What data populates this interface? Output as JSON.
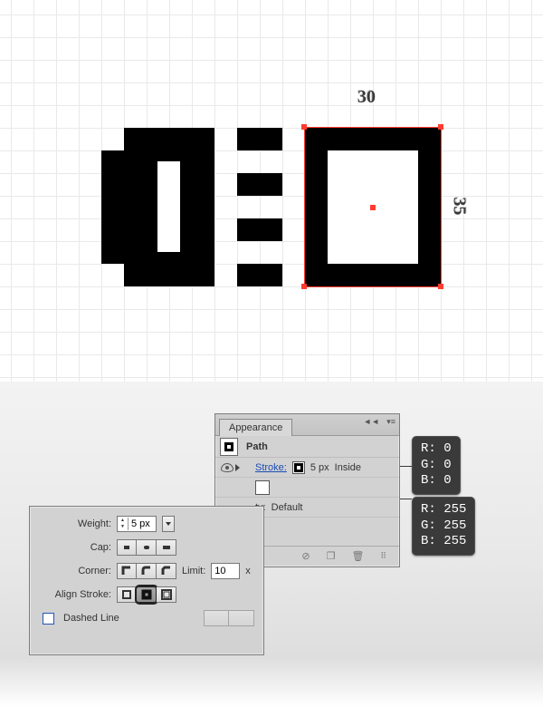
{
  "dims": {
    "w": "30",
    "h": "35"
  },
  "appearance": {
    "title": "Appearance",
    "objectLabel": "Path",
    "strokeLabel": "Stroke:",
    "strokeValue": "5 px",
    "strokeAlign": "Inside",
    "opacityLabel": "ty:",
    "opacityValue": "Default"
  },
  "rgb": {
    "strokeR": "R: 0",
    "strokeG": "G: 0",
    "strokeB": "B: 0",
    "fillR": "R: 255",
    "fillG": "G: 255",
    "fillB": "B: 255"
  },
  "stroke": {
    "weightLabel": "Weight:",
    "weightValue": "5 px",
    "capLabel": "Cap:",
    "cornerLabel": "Corner:",
    "limitLabel": "Limit:",
    "limitValue": "10",
    "limitSuffix": "x",
    "alignLabel": "Align Stroke:",
    "dashedLabel": "Dashed Line"
  }
}
